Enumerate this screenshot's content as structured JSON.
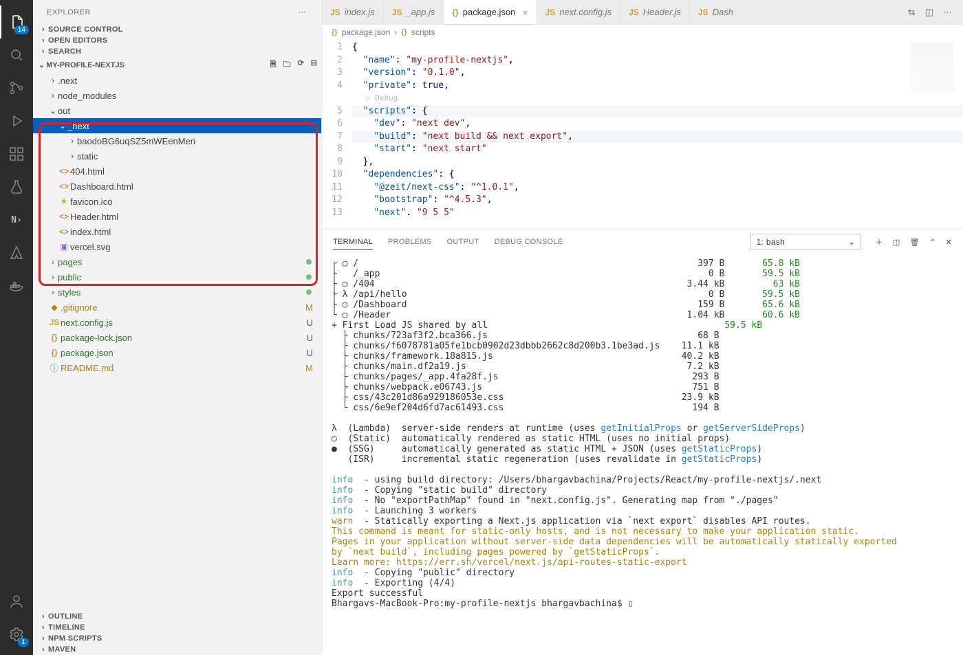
{
  "activity": {
    "explorer_badge": "14",
    "settings_badge": "1"
  },
  "sidebar": {
    "title": "EXPLORER",
    "sections": {
      "source_control": "SOURCE CONTROL",
      "open_editors": "OPEN EDITORS",
      "search": "SEARCH",
      "outline": "OUTLINE",
      "timeline": "TIMELINE",
      "npm_scripts": "NPM SCRIPTS",
      "maven": "MAVEN"
    },
    "project": "MY-PROFILE-NEXTJS",
    "tree": {
      "next_dir": ".next",
      "node_modules": "node_modules",
      "out": "out",
      "out_next": "_next",
      "out_hash": "baodoBG6uqSZ5mWEenMen",
      "out_static": "static",
      "out_404": "404.html",
      "out_dashboard": "Dashboard.html",
      "out_favicon": "favicon.ico",
      "out_header": "Header.html",
      "out_index": "index.html",
      "out_vercel": "vercel.svg",
      "pages": "pages",
      "public": "public",
      "styles": "styles",
      "gitignore": ".gitignore",
      "next_config": "next.config.js",
      "pkg_lock": "package-lock.json",
      "pkg": "package.json",
      "readme": "README.md"
    },
    "status": {
      "M": "M",
      "U": "U"
    }
  },
  "tabs": {
    "index": "index.js",
    "app": "_app.js",
    "pkg": "package.json",
    "nextcfg": "next.config.js",
    "header": "Header.js",
    "dash": "Dash"
  },
  "breadcrumb": {
    "file": "package.json",
    "symbol": "scripts"
  },
  "editor": {
    "lines": [
      {
        "n": "1",
        "html": "<span class='tok-pun'>{</span>"
      },
      {
        "n": "2",
        "html": "  <span class='tok-key'>\"name\"</span><span class='tok-pun'>: </span><span class='tok-str'>\"my-profile-nextjs\"</span><span class='tok-pun'>,</span>"
      },
      {
        "n": "3",
        "html": "  <span class='tok-key'>\"version\"</span><span class='tok-pun'>: </span><span class='tok-str'>\"0.1.0\"</span><span class='tok-pun'>,</span>"
      },
      {
        "n": "4",
        "html": "  <span class='tok-key'>\"private\"</span><span class='tok-pun'>: </span><span class='tok-lit'>true</span><span class='tok-pun'>,</span>"
      },
      {
        "n": "",
        "html": "<span class='debug-hint'>▷ Debug</span>"
      },
      {
        "n": "5",
        "html": "  <span class='tok-key'>\"scripts\"</span><span class='tok-pun'>: {</span>",
        "hl": true
      },
      {
        "n": "6",
        "html": "    <span class='tok-key'>\"dev\"</span><span class='tok-pun'>: </span><span class='tok-str'>\"next dev\"</span><span class='tok-pun'>,</span>"
      },
      {
        "n": "7",
        "html": "    <span class='tok-key'>\"build\"</span><span class='tok-pun'>: </span><span class='tok-str'>\"next build && next export\"</span><span class='tok-pun'>,</span>",
        "hl": true
      },
      {
        "n": "8",
        "html": "    <span class='tok-key'>\"start\"</span><span class='tok-pun'>: </span><span class='tok-str'>\"next start\"</span>"
      },
      {
        "n": "9",
        "html": "  <span class='tok-pun'>},</span>"
      },
      {
        "n": "10",
        "html": "  <span class='tok-key'>\"dependencies\"</span><span class='tok-pun'>: {</span>"
      },
      {
        "n": "11",
        "html": "    <span class='tok-key'>\"@zeit/next-css\"</span><span class='tok-pun'>: </span><span class='tok-str'>\"^1.0.1\"</span><span class='tok-pun'>,</span>"
      },
      {
        "n": "12",
        "html": "    <span class='tok-key'>\"bootstrap\"</span><span class='tok-pun'>: </span><span class='tok-str'>\"^4.5.3\"</span><span class='tok-pun'>,</span>"
      },
      {
        "n": "13",
        "html": "    <span class='tok-key'>\"next\"</span><span class='tok-pun'>. </span><span class='tok-str'>\"9 5 5\"</span>"
      }
    ]
  },
  "panel": {
    "tabs": {
      "terminal": "TERMINAL",
      "problems": "PROBLEMS",
      "output": "OUTPUT",
      "debug": "DEBUG CONSOLE"
    },
    "shell": "1: bash"
  },
  "terminal": {
    "routes": [
      {
        "m": "○",
        "p": "/",
        "s": "397 B",
        "l": "65.8 kB"
      },
      {
        "m": " ",
        "p": "/_app",
        "s": "0 B",
        "l": "59.5 kB"
      },
      {
        "m": "○",
        "p": "/404",
        "s": "3.44 kB",
        "l": "63 kB"
      },
      {
        "m": "λ",
        "p": "/api/hello",
        "s": "0 B",
        "l": "59.5 kB"
      },
      {
        "m": "○",
        "p": "/Dashboard",
        "s": "159 B",
        "l": "65.6 kB"
      },
      {
        "m": "○",
        "p": "/Header",
        "s": "1.04 kB",
        "l": "60.6 kB"
      }
    ],
    "shared_label": "+ First Load JS shared by all",
    "shared_size": "59.5 kB",
    "chunks": [
      {
        "p": "chunks/723af3f2.bca366.js",
        "s": "68 B"
      },
      {
        "p": "chunks/f6078781a05fe1bcb0902d23dbbb2662c8d200b3.1be3ad.js",
        "s": "11.1 kB"
      },
      {
        "p": "chunks/framework.18a815.js",
        "s": "40.2 kB"
      },
      {
        "p": "chunks/main.df2a19.js",
        "s": "7.2 kB"
      },
      {
        "p": "chunks/pages/_app.4fa28f.js",
        "s": "293 B"
      },
      {
        "p": "chunks/webpack.e06743.js",
        "s": "751 B"
      },
      {
        "p": "css/43c201d86a929186053e.css",
        "s": "23.9 kB"
      },
      {
        "p": "css/6e9ef204d6fd7ac61493.css",
        "s": "194 B"
      }
    ],
    "legend": {
      "lambda": "λ  (Lambda)  server-side renders at runtime (uses ",
      "lambda_fns": [
        "getInitialProps",
        " or ",
        "getServerSideProps",
        ")"
      ],
      "static": "○  (Static)  automatically rendered as static HTML (uses no initial props)",
      "ssg": "●  (SSG)     automatically generated as static HTML + JSON (uses ",
      "ssg_fn": "getStaticProps",
      "isr": "   (ISR)     incremental static regeneration (uses revalidate in ",
      "isr_fn": "getStaticProps"
    },
    "logs": [
      {
        "t": "info",
        "msg": "  - using build directory: /Users/bhargavbachina/Projects/React/my-profile-nextjs/.next"
      },
      {
        "t": "info",
        "msg": "  - Copying \"static build\" directory"
      },
      {
        "t": "info",
        "msg": "  - No \"exportPathMap\" found in \"next.config.js\". Generating map from \"./pages\""
      },
      {
        "t": "info",
        "msg": "  - Launching 3 workers"
      },
      {
        "t": "warn",
        "msg": "  - Statically exporting a Next.js application via `next export` disables API routes."
      }
    ],
    "warn_block": [
      "This command is meant for static-only hosts, and is not necessary to make your application static.",
      "Pages in your application without server-side data dependencies will be automatically statically exported",
      "by `next build`, including pages powered by `getStaticProps`.",
      "Learn more: https://err.sh/vercel/next.js/api-routes-static-export"
    ],
    "logs2": [
      {
        "t": "info",
        "msg": "  - Copying \"public\" directory"
      },
      {
        "t": "info",
        "msg": "  - Exporting (4/4)"
      }
    ],
    "tail": [
      "Export successful",
      "Bhargavs-MacBook-Pro:my-profile-nextjs bhargavbachina$ ▯"
    ]
  }
}
